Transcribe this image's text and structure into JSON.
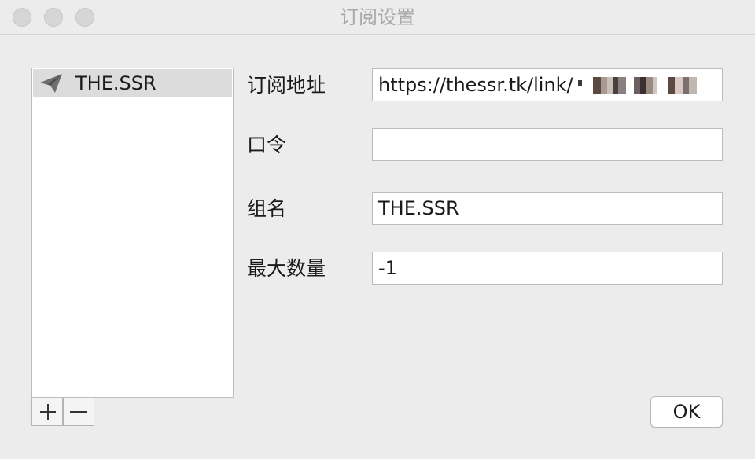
{
  "window": {
    "title": "订阅设置"
  },
  "list": {
    "items": [
      {
        "label": "THE.SSR",
        "icon": "paper-plane-icon",
        "selected": true
      }
    ],
    "add_button_icon": "plus-icon",
    "remove_button_icon": "minus-icon"
  },
  "form": {
    "url_label": "订阅地址",
    "url_value": "https://thessr.tk/link/",
    "password_label": "口令",
    "password_value": "",
    "group_label": "组名",
    "group_value": "THE.SSR",
    "max_count_label": "最大数量",
    "max_count_value": "-1"
  },
  "buttons": {
    "ok_label": "OK"
  },
  "colors": {
    "window_bg": "#ececec",
    "selected_row_bg": "#dcdcdc",
    "title_text": "#a8a8a8"
  }
}
